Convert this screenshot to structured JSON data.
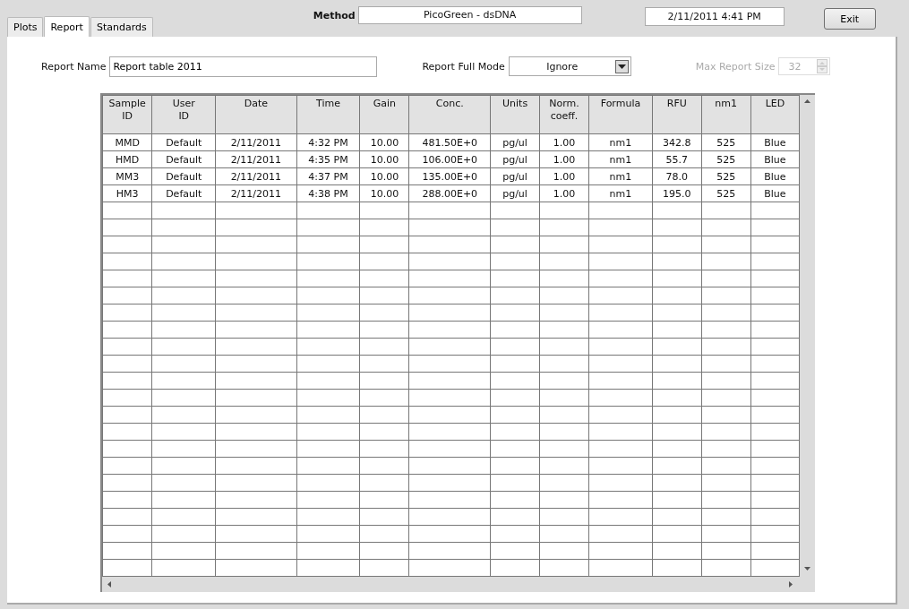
{
  "tabs": [
    {
      "label": "Plots",
      "selected": false
    },
    {
      "label": "Report",
      "selected": true
    },
    {
      "label": "Standards",
      "selected": false
    }
  ],
  "method": {
    "label": "Method",
    "value": "PicoGreen - dsDNA"
  },
  "datetime": "2/11/2011  4:41 PM",
  "exit_button": "Exit",
  "report_name": {
    "label": "Report Name",
    "value": "Report table 2011"
  },
  "report_full_mode": {
    "label": "Report Full Mode",
    "value": "Ignore"
  },
  "max_report_size": {
    "label": "Max Report Size",
    "value": "32",
    "disabled": true
  },
  "table": {
    "columns": [
      "Sample\nID",
      "User\nID",
      "Date",
      "Time",
      "Gain",
      "Conc.",
      "Units",
      "Norm.\ncoeff.",
      "Formula",
      "RFU",
      "nm1",
      "LED"
    ],
    "rows": [
      [
        "MMD",
        "Default",
        "2/11/2011",
        "4:32 PM",
        "10.00",
        "481.50E+0",
        "pg/ul",
        "1.00",
        "nm1",
        "342.8",
        "525",
        "Blue"
      ],
      [
        "HMD",
        "Default",
        "2/11/2011",
        "4:35 PM",
        "10.00",
        "106.00E+0",
        "pg/ul",
        "1.00",
        "nm1",
        "55.7",
        "525",
        "Blue"
      ],
      [
        "MM3",
        "Default",
        "2/11/2011",
        "4:37 PM",
        "10.00",
        "135.00E+0",
        "pg/ul",
        "1.00",
        "nm1",
        "78.0",
        "525",
        "Blue"
      ],
      [
        "HM3",
        "Default",
        "2/11/2011",
        "4:38 PM",
        "10.00",
        "288.00E+0",
        "pg/ul",
        "1.00",
        "nm1",
        "195.0",
        "525",
        "Blue"
      ]
    ]
  }
}
